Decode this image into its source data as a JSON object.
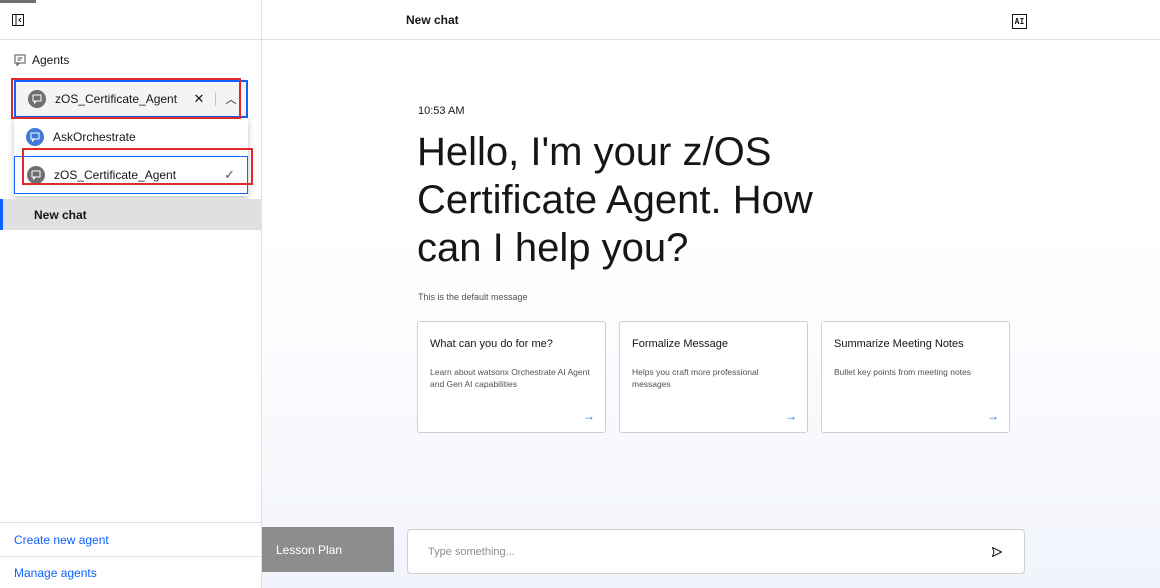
{
  "sidebar": {
    "agents_label": "Agents",
    "selected_agent": "zOS_Certificate_Agent",
    "menu_items": [
      {
        "label": "AskOrchestrate"
      },
      {
        "label": "zOS_Certificate_Agent"
      }
    ],
    "new_chat": "New chat",
    "create_agent": "Create new agent",
    "manage_agents": "Manage agents"
  },
  "header": {
    "title": "New chat",
    "ai_badge": "AI"
  },
  "main": {
    "time": "10:53 AM",
    "greeting": "Hello, I'm your z/OS Certificate Agent. How can I help you?",
    "default_message": "This is the default message",
    "cards": [
      {
        "title": "What can you do for me?",
        "desc": "Learn about watsonx Orchestrate AI Agent and Gen AI capabilities"
      },
      {
        "title": "Formalize Message",
        "desc": "Helps you craft more professional messages"
      },
      {
        "title": "Summarize Meeting Notes",
        "desc": "Bullet key points from meeting notes"
      }
    ],
    "lesson_plan": "Lesson Plan",
    "input_placeholder": "Type something..."
  },
  "colors": {
    "accent": "#0f62fe",
    "highlight_box": "#e02a2a"
  }
}
